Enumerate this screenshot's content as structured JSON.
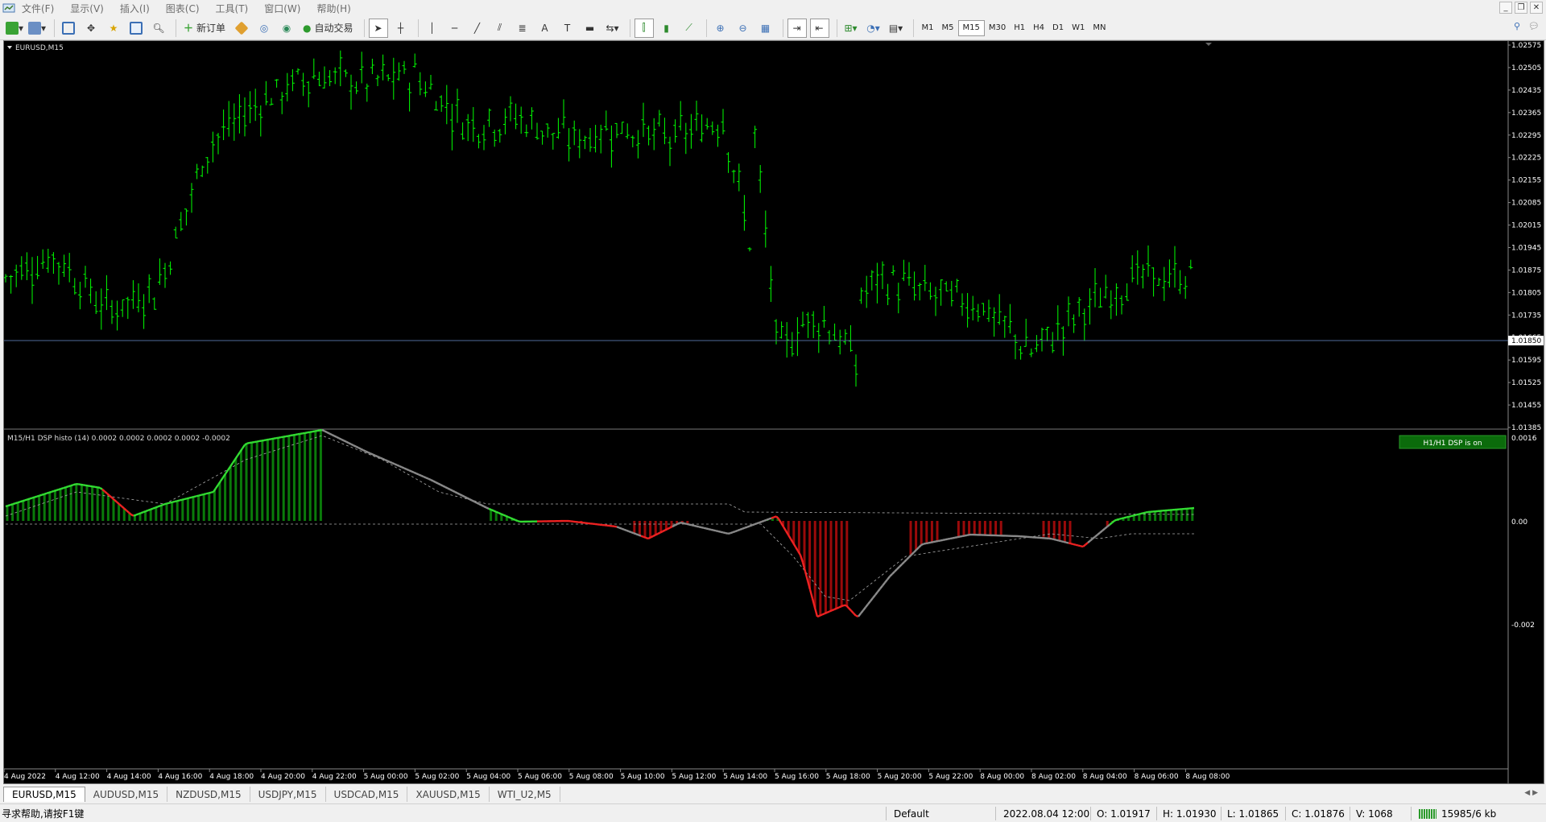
{
  "menu": [
    "文件(F)",
    "显示(V)",
    "插入(I)",
    "图表(C)",
    "工具(T)",
    "窗口(W)",
    "帮助(H)"
  ],
  "toolbar": {
    "new_order_label": "新订单",
    "auto_trade_label": "自动交易",
    "timeframes": [
      "M1",
      "M5",
      "M15",
      "M30",
      "H1",
      "H4",
      "D1",
      "W1",
      "MN"
    ],
    "active_timeframe": "M15"
  },
  "chart": {
    "symbol_label": "EURUSD,M15",
    "current_price_label": "1.01850",
    "price_scale": [
      "1.02575",
      "1.02505",
      "1.02435",
      "1.02365",
      "1.02295",
      "1.02225",
      "1.02155",
      "1.02085",
      "1.02015",
      "1.01945",
      "1.01875",
      "1.01805",
      "1.01735",
      "1.01665",
      "1.01595",
      "1.01525",
      "1.01455",
      "1.01385"
    ],
    "indicator_label": "M15/H1 DSP histo (14) 0.0002 0.0002 0.0002 0.0002 -0.0002",
    "indicator_scale": [
      "0.0016",
      "0.00",
      "-0.002"
    ],
    "indicator_badge": "H1/H1 DSP is on",
    "time_labels": [
      "4 Aug 2022",
      "4 Aug 12:00",
      "4 Aug 14:00",
      "4 Aug 16:00",
      "4 Aug 18:00",
      "4 Aug 20:00",
      "4 Aug 22:00",
      "5 Aug 00:00",
      "5 Aug 02:00",
      "5 Aug 04:00",
      "5 Aug 06:00",
      "5 Aug 08:00",
      "5 Aug 10:00",
      "5 Aug 12:00",
      "5 Aug 14:00",
      "5 Aug 16:00",
      "5 Aug 18:00",
      "5 Aug 20:00",
      "5 Aug 22:00",
      "8 Aug 00:00",
      "8 Aug 02:00",
      "8 Aug 04:00",
      "8 Aug 06:00",
      "8 Aug 08:00"
    ],
    "colors": {
      "bar": "#00ff00",
      "price_line": "#4f6b9a",
      "hist_up": "#0a7a0a",
      "hist_down": "#9a0a0a",
      "line_up": "#33dd33",
      "line_down": "#ee2222",
      "line_neutral": "#8a8a8a",
      "badge_bg": "#0b6b0b"
    }
  },
  "chart_data": {
    "type": "line",
    "title": "EURUSD,M15",
    "close_points": [
      {
        "x": "4 Aug 2022",
        "y": 1.0185
      },
      {
        "x": "4 Aug 12:00",
        "y": 1.0192
      },
      {
        "x": "4 Aug 14:00",
        "y": 1.0175
      },
      {
        "x": "4 Aug 16:00",
        "y": 1.0182
      },
      {
        "x": "4 Aug 18:00",
        "y": 1.0227
      },
      {
        "x": "4 Aug 20:00",
        "y": 1.024
      },
      {
        "x": "4 Aug 22:00",
        "y": 1.0248
      },
      {
        "x": "5 Aug 00:00",
        "y": 1.0246
      },
      {
        "x": "5 Aug 02:00",
        "y": 1.0248
      },
      {
        "x": "5 Aug 04:00",
        "y": 1.0233
      },
      {
        "x": "5 Aug 06:00",
        "y": 1.0235
      },
      {
        "x": "5 Aug 08:00",
        "y": 1.0228
      },
      {
        "x": "5 Aug 10:00",
        "y": 1.0232
      },
      {
        "x": "5 Aug 12:00",
        "y": 1.0228
      },
      {
        "x": "5 Aug 14:00",
        "y": 1.0235
      },
      {
        "x": "5 Aug 16:00",
        "y": 1.016
      },
      {
        "x": "5 Aug 18:00",
        "y": 1.0165
      },
      {
        "x": "5 Aug 20:00",
        "y": 1.0185
      },
      {
        "x": "5 Aug 22:00",
        "y": 1.018
      },
      {
        "x": "8 Aug 00:00",
        "y": 1.0177
      },
      {
        "x": "8 Aug 02:00",
        "y": 1.0162
      },
      {
        "x": "8 Aug 04:00",
        "y": 1.0175
      },
      {
        "x": "8 Aug 06:00",
        "y": 1.0185
      },
      {
        "x": "8 Aug 08:00",
        "y": 1.0185
      }
    ],
    "ylim": [
      1.01385,
      1.02575
    ]
  },
  "tabs": [
    "EURUSD,M15",
    "AUDUSD,M15",
    "NZDUSD,M15",
    "USDJPY,M15",
    "USDCAD,M15",
    "XAUUSD,M15",
    "WTI_U2,M5"
  ],
  "status": {
    "help": "寻求帮助,请按F1键",
    "profile": "Default",
    "datetime": "2022.08.04 12:00",
    "open": "O: 1.01917",
    "high": "H: 1.01930",
    "low": "L: 1.01865",
    "close": "C: 1.01876",
    "volume": "V: 1068",
    "traffic": "15985/6 kb"
  }
}
